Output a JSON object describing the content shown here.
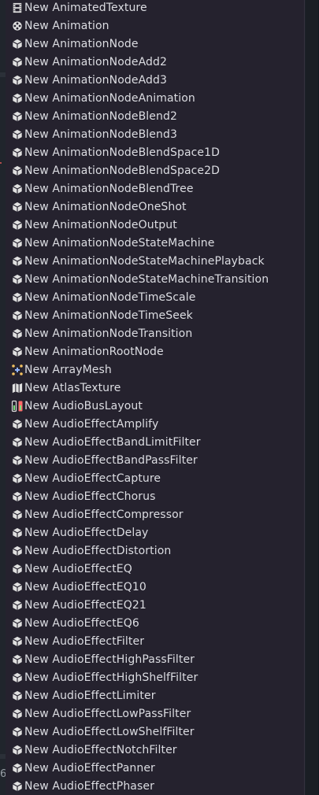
{
  "colors": {
    "popup_bg": "#25222e",
    "text": "#dcdde2",
    "icon_default": "#e0e0e0",
    "icon_mesh_dots": "#f0c060",
    "icon_mesh_plus": "#8fb4ff",
    "icon_bus_red": "#ff6a6a",
    "icon_bus_green": "#7de27d"
  },
  "background_fragment": "6",
  "menu": {
    "items": [
      {
        "label": "New AnimatedTexture",
        "icon": "film-icon"
      },
      {
        "label": "New Animation",
        "icon": "animation-icon"
      },
      {
        "label": "New AnimationNode",
        "icon": "resource-cube-icon"
      },
      {
        "label": "New AnimationNodeAdd2",
        "icon": "resource-cube-icon"
      },
      {
        "label": "New AnimationNodeAdd3",
        "icon": "resource-cube-icon"
      },
      {
        "label": "New AnimationNodeAnimation",
        "icon": "resource-cube-icon"
      },
      {
        "label": "New AnimationNodeBlend2",
        "icon": "resource-cube-icon"
      },
      {
        "label": "New AnimationNodeBlend3",
        "icon": "resource-cube-icon"
      },
      {
        "label": "New AnimationNodeBlendSpace1D",
        "icon": "resource-cube-icon"
      },
      {
        "label": "New AnimationNodeBlendSpace2D",
        "icon": "resource-cube-icon"
      },
      {
        "label": "New AnimationNodeBlendTree",
        "icon": "resource-cube-icon"
      },
      {
        "label": "New AnimationNodeOneShot",
        "icon": "resource-cube-icon"
      },
      {
        "label": "New AnimationNodeOutput",
        "icon": "resource-cube-icon"
      },
      {
        "label": "New AnimationNodeStateMachine",
        "icon": "resource-cube-icon"
      },
      {
        "label": "New AnimationNodeStateMachinePlayback",
        "icon": "resource-cube-icon"
      },
      {
        "label": "New AnimationNodeStateMachineTransition",
        "icon": "resource-cube-icon"
      },
      {
        "label": "New AnimationNodeTimeScale",
        "icon": "resource-cube-icon"
      },
      {
        "label": "New AnimationNodeTimeSeek",
        "icon": "resource-cube-icon"
      },
      {
        "label": "New AnimationNodeTransition",
        "icon": "resource-cube-icon"
      },
      {
        "label": "New AnimationRootNode",
        "icon": "resource-cube-icon"
      },
      {
        "label": "New ArrayMesh",
        "icon": "array-mesh-icon"
      },
      {
        "label": "New AtlasTexture",
        "icon": "atlas-map-icon"
      },
      {
        "label": "New AudioBusLayout",
        "icon": "audio-bus-layout-icon"
      },
      {
        "label": "New AudioEffectAmplify",
        "icon": "resource-cube-icon"
      },
      {
        "label": "New AudioEffectBandLimitFilter",
        "icon": "resource-cube-icon"
      },
      {
        "label": "New AudioEffectBandPassFilter",
        "icon": "resource-cube-icon"
      },
      {
        "label": "New AudioEffectCapture",
        "icon": "resource-cube-icon"
      },
      {
        "label": "New AudioEffectChorus",
        "icon": "resource-cube-icon"
      },
      {
        "label": "New AudioEffectCompressor",
        "icon": "resource-cube-icon"
      },
      {
        "label": "New AudioEffectDelay",
        "icon": "resource-cube-icon"
      },
      {
        "label": "New AudioEffectDistortion",
        "icon": "resource-cube-icon"
      },
      {
        "label": "New AudioEffectEQ",
        "icon": "resource-cube-icon"
      },
      {
        "label": "New AudioEffectEQ10",
        "icon": "resource-cube-icon"
      },
      {
        "label": "New AudioEffectEQ21",
        "icon": "resource-cube-icon"
      },
      {
        "label": "New AudioEffectEQ6",
        "icon": "resource-cube-icon"
      },
      {
        "label": "New AudioEffectFilter",
        "icon": "resource-cube-icon"
      },
      {
        "label": "New AudioEffectHighPassFilter",
        "icon": "resource-cube-icon"
      },
      {
        "label": "New AudioEffectHighShelfFilter",
        "icon": "resource-cube-icon"
      },
      {
        "label": "New AudioEffectLimiter",
        "icon": "resource-cube-icon"
      },
      {
        "label": "New AudioEffectLowPassFilter",
        "icon": "resource-cube-icon"
      },
      {
        "label": "New AudioEffectLowShelfFilter",
        "icon": "resource-cube-icon"
      },
      {
        "label": "New AudioEffectNotchFilter",
        "icon": "resource-cube-icon"
      },
      {
        "label": "New AudioEffectPanner",
        "icon": "resource-cube-icon"
      },
      {
        "label": "New AudioEffectPhaser",
        "icon": "resource-cube-icon"
      }
    ]
  }
}
